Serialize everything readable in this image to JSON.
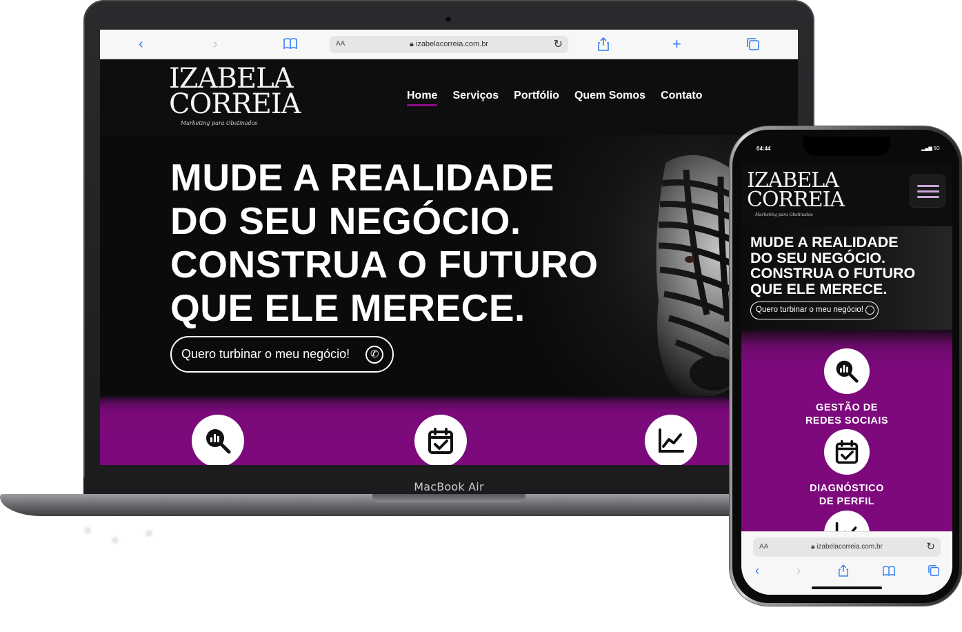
{
  "laptop": {
    "model_label": "MacBook Air",
    "browser": {
      "url": "izabelacorreia.com.br",
      "text_size_label": "AA",
      "icons": [
        "back-icon",
        "forward-icon",
        "bookmarks-icon",
        "reload-icon",
        "share-icon",
        "new-tab-icon",
        "tabs-icon"
      ]
    },
    "site": {
      "logo": {
        "line1": "IZABELA",
        "line2": "CORREIA",
        "tagline": "Marketing para Obstinados"
      },
      "nav": [
        {
          "label": "Home",
          "active": true
        },
        {
          "label": "Serviços",
          "active": false
        },
        {
          "label": "Portfólio",
          "active": false
        },
        {
          "label": "Quem Somos",
          "active": false
        },
        {
          "label": "Contato",
          "active": false
        }
      ],
      "hero": {
        "lines": [
          "MUDE A REALIDADE",
          "DO SEU NEGÓCIO.",
          "CONSTRUA O FUTURO",
          "QUE ELE MERECE."
        ],
        "cta_label": "Quero turbinar o meu negócio!"
      },
      "service_icons": [
        "analytics-search-icon",
        "calendar-check-icon",
        "trend-chart-icon"
      ]
    }
  },
  "phone": {
    "status": {
      "time": "04:44",
      "network": "5G"
    },
    "site": {
      "logo": {
        "line1": "IZABELA",
        "line2": "CORREIA",
        "tagline": "Marketing para Obstinados"
      },
      "hero": {
        "lines": [
          "MUDE A REALIDADE",
          "DO SEU NEGÓCIO.",
          "CONSTRUA O FUTURO",
          "QUE ELE MERECE."
        ],
        "cta_label": "Quero turbinar o meu negócio!"
      },
      "services": [
        {
          "icon": "analytics-search-icon",
          "line1": "GESTÃO DE",
          "line2": "REDES SOCIAIS"
        },
        {
          "icon": "calendar-check-icon",
          "line1": "DIAGNÓSTICO",
          "line2": "DE PERFIL"
        },
        {
          "icon": "trend-chart-icon",
          "line1": "",
          "line2": ""
        }
      ]
    },
    "browser": {
      "url": "izabelacorreia.com.br",
      "text_size_label": "AA"
    }
  },
  "colors": {
    "accent_purple": "#7d097d",
    "nav_underline": "#8b0e8b",
    "safari_blue": "#2f7cf6",
    "background": "#0e0e0e"
  }
}
